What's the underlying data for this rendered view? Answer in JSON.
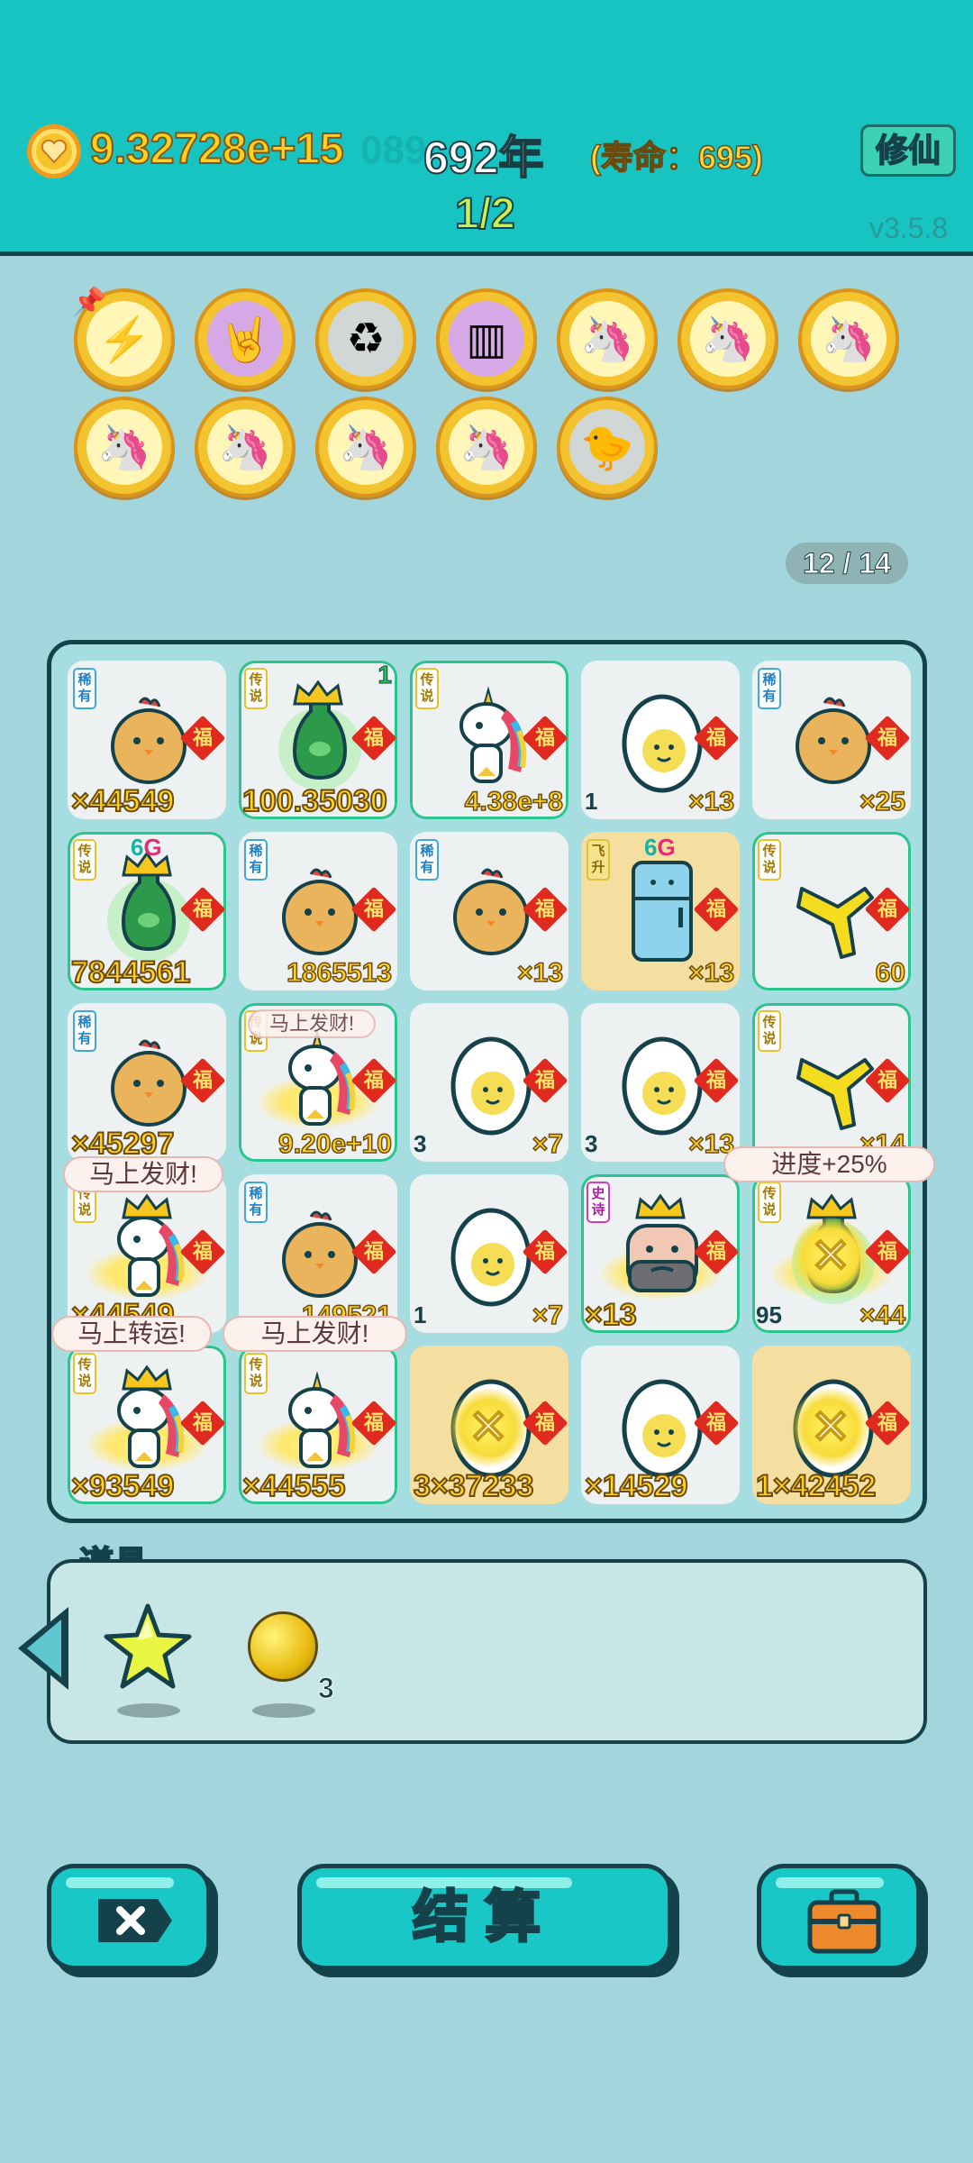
{
  "header": {
    "coins": "9.32728e+15",
    "coins_ghost": "089",
    "year": "692年",
    "lifespan": "(寿命：695)",
    "cultivate_label": "修仙",
    "page_indicator": "1/2",
    "version": "v3.5.8"
  },
  "buffs": [
    {
      "name": "lightning-icon",
      "glyph": "⚡",
      "style": "yellow"
    },
    {
      "name": "rock-hand-icon",
      "glyph": "🤘",
      "style": "purple"
    },
    {
      "name": "recycle-icon",
      "glyph": "♻",
      "style": "gray"
    },
    {
      "name": "skirt-icon",
      "glyph": "▥",
      "style": "purple"
    },
    {
      "name": "unicorn-icon",
      "glyph": "🦄",
      "style": "yellow"
    },
    {
      "name": "unicorn-icon",
      "glyph": "🦄",
      "style": "yellow"
    },
    {
      "name": "unicorn-icon",
      "glyph": "🦄",
      "style": "yellow"
    },
    {
      "name": "unicorn-icon",
      "glyph": "🦄",
      "style": "yellow"
    },
    {
      "name": "unicorn-icon",
      "glyph": "🦄",
      "style": "yellow"
    },
    {
      "name": "unicorn-icon",
      "glyph": "🦄",
      "style": "yellow"
    },
    {
      "name": "unicorn-icon",
      "glyph": "🦄",
      "style": "yellow"
    },
    {
      "name": "chick-icon",
      "glyph": "🐤",
      "style": "gray"
    }
  ],
  "slot_count": "12 / 14",
  "fu_label": "福",
  "grid": [
    {
      "tag": "稀有",
      "tagc": "b",
      "art": "chick",
      "bl": "",
      "br": "",
      "big": "×44549"
    },
    {
      "tag": "传说",
      "tagc": "y",
      "art": "vase",
      "bl": "",
      "br": "",
      "big": "100.35030",
      "tr": "1",
      "crown": true,
      "glow": true
    },
    {
      "tag": "传说",
      "tagc": "y",
      "art": "unicorn",
      "bl": "",
      "br": "4.38e+8",
      "glow": true
    },
    {
      "tag": "",
      "art": "egg",
      "bl": "1",
      "br": "×13"
    },
    {
      "tag": "稀有",
      "tagc": "b",
      "art": "chick",
      "bl": "",
      "br": "×25"
    },
    {
      "tag": "传说",
      "tagc": "y",
      "art": "vase",
      "bl": "",
      "br": "",
      "big": "7844561",
      "sixg": true,
      "crown": true,
      "glow": true
    },
    {
      "tag": "稀有",
      "tagc": "b",
      "art": "chick",
      "bl": "",
      "br": "1865513"
    },
    {
      "tag": "稀有",
      "tagc": "b",
      "art": "chick",
      "bl": "",
      "br": "×13"
    },
    {
      "tag": "飞升",
      "tagc": "o",
      "art": "fridge",
      "bl": "",
      "br": "×13",
      "sixg": true,
      "yellow": true
    },
    {
      "tag": "传说",
      "tagc": "y",
      "art": "hand",
      "bl": "",
      "br": "60",
      "glow": true
    },
    {
      "tag": "稀有",
      "tagc": "b",
      "art": "chick",
      "bl": "",
      "br": "",
      "big": "×45297"
    },
    {
      "tag": "传说",
      "tagc": "y",
      "art": "unicorn",
      "bl": "",
      "br": "9.20e+10",
      "glow": true,
      "halo": true
    },
    {
      "tag": "",
      "art": "egg",
      "bl": "3",
      "br": "×7"
    },
    {
      "tag": "",
      "art": "egg",
      "bl": "3",
      "br": "×13"
    },
    {
      "tag": "传说",
      "tagc": "y",
      "art": "hand",
      "bl": "",
      "br": "×14",
      "glow": true
    },
    {
      "tag": "传说",
      "tagc": "y",
      "art": "unicorn",
      "bl": "",
      "br": "",
      "big": "×44549",
      "crown": true,
      "halo": true
    },
    {
      "tag": "稀有",
      "tagc": "b",
      "art": "chick",
      "bl": "",
      "br": "149521"
    },
    {
      "tag": "",
      "art": "egg",
      "bl": "1",
      "br": "×7"
    },
    {
      "tag": "史诗",
      "tagc": "m",
      "art": "face",
      "bl": "",
      "br": "",
      "big": "×13",
      "crown": true,
      "glow": true,
      "halo": true
    },
    {
      "tag": "传说",
      "tagc": "y",
      "art": "vase",
      "bl": "95",
      "br": "×44",
      "crown": true,
      "glow": true,
      "halo": true,
      "xmark": true
    },
    {
      "tag": "传说",
      "tagc": "y",
      "art": "unicorn",
      "bl": "",
      "br": "",
      "big": "×93549",
      "crown": true,
      "glow": true,
      "halo": true
    },
    {
      "tag": "传说",
      "tagc": "y",
      "art": "unicorn",
      "bl": "",
      "br": "",
      "big": "×44555",
      "glow": true,
      "halo": true
    },
    {
      "tag": "",
      "art": "egg",
      "bl": "",
      "br": "",
      "big": "3×37233",
      "yellow": true,
      "xmark": true
    },
    {
      "tag": "",
      "art": "egg",
      "bl": "",
      "br": "",
      "big": "×14529"
    },
    {
      "tag": "",
      "art": "egg",
      "bl": "",
      "br": "",
      "big": "1×42452",
      "yellow": true,
      "xmark": true
    }
  ],
  "bubbles": {
    "b1": "马上发财!",
    "b2": "马上发财!",
    "b3": "马上转运!",
    "b4": "马上发财!",
    "b5": "进度+25%"
  },
  "props": {
    "title": "道具",
    "ball_qty": "3"
  },
  "bottom": {
    "settle_label": "结算"
  },
  "colors": {
    "header": "#17c4c2",
    "background": "#a3d5dc",
    "coin_text": "#ffd21f",
    "outline": "#14414a"
  }
}
